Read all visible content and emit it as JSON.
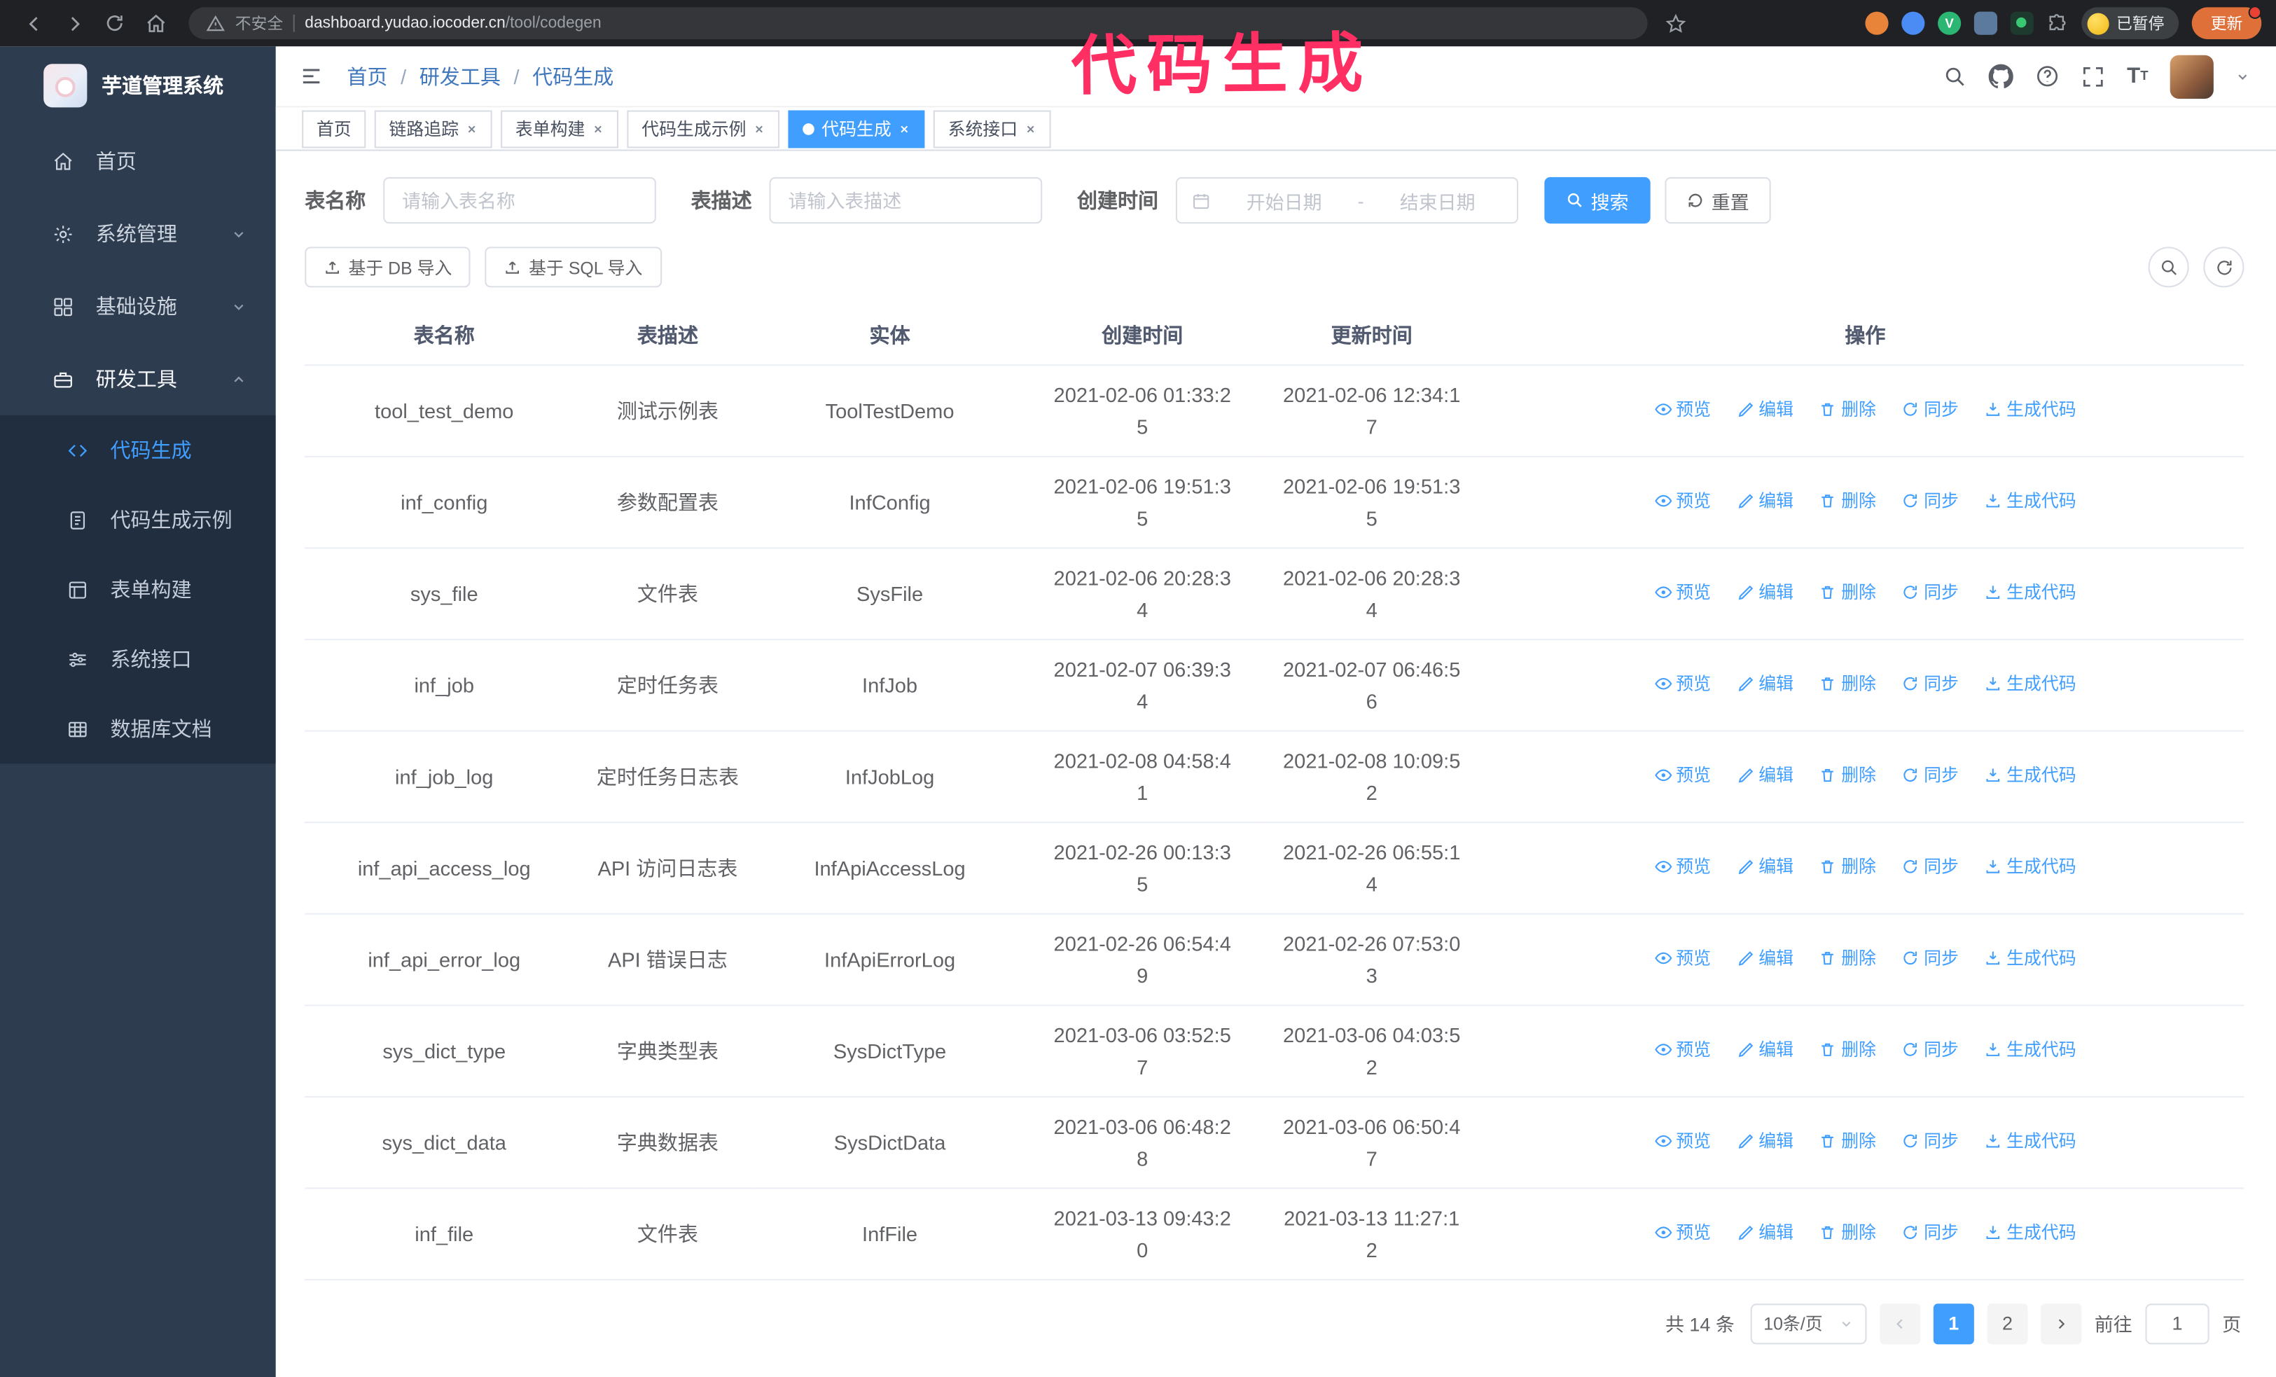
{
  "annotation": {
    "title": "代码生成"
  },
  "colors": {
    "primary": "#409eff",
    "sidebar_bg": "#2e3c50",
    "submenu_bg": "#202e3f",
    "annotation": "#ff2e63",
    "active_tab": "#409eff"
  },
  "browser": {
    "security_label": "不安全",
    "url_host": "dashboard.yudao.iocoder.cn",
    "url_path": "/tool/codegen",
    "paused_badge": "已暂停",
    "update_button": "更新"
  },
  "sidebar": {
    "logo_title": "芋道管理系统",
    "items": [
      {
        "label": "首页",
        "icon": "home-icon"
      },
      {
        "label": "系统管理",
        "icon": "gear-icon"
      },
      {
        "label": "基础设施",
        "icon": "grid-icon"
      },
      {
        "label": "研发工具",
        "icon": "toolbox-icon"
      }
    ],
    "submenu": [
      {
        "label": "代码生成",
        "icon": "code-icon",
        "active": true
      },
      {
        "label": "代码生成示例",
        "icon": "document-icon"
      },
      {
        "label": "表单构建",
        "icon": "form-icon"
      },
      {
        "label": "系统接口",
        "icon": "sliders-icon"
      },
      {
        "label": "数据库文档",
        "icon": "table-grid-icon"
      }
    ]
  },
  "breadcrumb": {
    "items": [
      "首页",
      "研发工具",
      "代码生成"
    ],
    "separator": "/"
  },
  "tabs": [
    {
      "label": "首页",
      "closable": false
    },
    {
      "label": "链路追踪",
      "closable": true
    },
    {
      "label": "表单构建",
      "closable": true
    },
    {
      "label": "代码生成示例",
      "closable": true
    },
    {
      "label": "代码生成",
      "closable": true,
      "active": true
    },
    {
      "label": "系统接口",
      "closable": true
    }
  ],
  "filters": {
    "table_name_label": "表名称",
    "table_name_placeholder": "请输入表名称",
    "table_desc_label": "表描述",
    "table_desc_placeholder": "请输入表描述",
    "create_time_label": "创建时间",
    "date_start_placeholder": "开始日期",
    "date_separator": "-",
    "date_end_placeholder": "结束日期",
    "search_button": "搜索",
    "reset_button": "重置"
  },
  "toolbar": {
    "import_db": "基于 DB 导入",
    "import_sql": "基于 SQL 导入"
  },
  "table": {
    "columns": [
      "表名称",
      "表描述",
      "实体",
      "创建时间",
      "更新时间",
      "操作"
    ],
    "actions": [
      {
        "label": "预览",
        "icon": "eye-icon"
      },
      {
        "label": "编辑",
        "icon": "edit-icon"
      },
      {
        "label": "删除",
        "icon": "delete-icon"
      },
      {
        "label": "同步",
        "icon": "sync-icon"
      },
      {
        "label": "生成代码",
        "icon": "download-icon"
      }
    ],
    "rows": [
      {
        "name": "tool_test_demo",
        "desc": "测试示例表",
        "entity": "ToolTestDemo",
        "created": "2021-02-06 01:33:25",
        "updated": "2021-02-06 12:34:17"
      },
      {
        "name": "inf_config",
        "desc": "参数配置表",
        "entity": "InfConfig",
        "created": "2021-02-06 19:51:35",
        "updated": "2021-02-06 19:51:35"
      },
      {
        "name": "sys_file",
        "desc": "文件表",
        "entity": "SysFile",
        "created": "2021-02-06 20:28:34",
        "updated": "2021-02-06 20:28:34"
      },
      {
        "name": "inf_job",
        "desc": "定时任务表",
        "entity": "InfJob",
        "created": "2021-02-07 06:39:34",
        "updated": "2021-02-07 06:46:56"
      },
      {
        "name": "inf_job_log",
        "desc": "定时任务日志表",
        "entity": "InfJobLog",
        "created": "2021-02-08 04:58:41",
        "updated": "2021-02-08 10:09:52"
      },
      {
        "name": "inf_api_access_log",
        "desc": "API 访问日志表",
        "entity": "InfApiAccessLog",
        "created": "2021-02-26 00:13:35",
        "updated": "2021-02-26 06:55:14"
      },
      {
        "name": "inf_api_error_log",
        "desc": "API 错误日志",
        "entity": "InfApiErrorLog",
        "created": "2021-02-26 06:54:49",
        "updated": "2021-02-26 07:53:03"
      },
      {
        "name": "sys_dict_type",
        "desc": "字典类型表",
        "entity": "SysDictType",
        "created": "2021-03-06 03:52:57",
        "updated": "2021-03-06 04:03:52"
      },
      {
        "name": "sys_dict_data",
        "desc": "字典数据表",
        "entity": "SysDictData",
        "created": "2021-03-06 06:48:28",
        "updated": "2021-03-06 06:50:47"
      },
      {
        "name": "inf_file",
        "desc": "文件表",
        "entity": "InfFile",
        "created": "2021-03-13 09:43:20",
        "updated": "2021-03-13 11:27:12"
      }
    ]
  },
  "pagination": {
    "total": "共 14 条",
    "page_size": "10条/页",
    "pages": [
      "1",
      "2"
    ],
    "active_page": "1",
    "goto_label": "前往",
    "goto_value": "1",
    "goto_suffix": "页"
  }
}
